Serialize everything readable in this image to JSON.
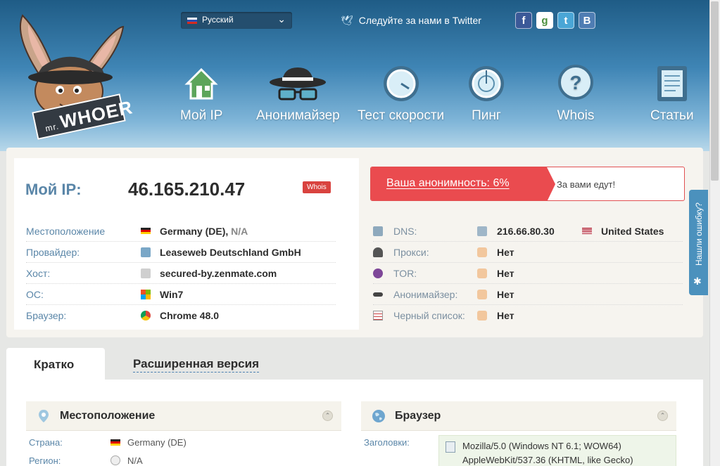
{
  "header": {
    "language": "Русский",
    "twitter_text": "Следуйте за нами в Twitter",
    "social": [
      {
        "name": "facebook",
        "glyph": "f",
        "color": "#3b5998"
      },
      {
        "name": "google",
        "glyph": "g",
        "color": "#4a8f3c"
      },
      {
        "name": "twitter",
        "glyph": "t",
        "color": "#4aa6d6"
      },
      {
        "name": "vk",
        "glyph": "B",
        "color": "#4f7db3"
      }
    ],
    "logo_text": "WHOER",
    "logo_prefix": "mr.",
    "nav": [
      "Мой IP",
      "Анонимайзер",
      "Тест скорости",
      "Пинг",
      "Whois",
      "Статьи"
    ]
  },
  "ip_card": {
    "label": "Мой IP:",
    "ip": "46.165.210.47",
    "whois_badge": "Whois",
    "rows": [
      {
        "label": "Местоположение",
        "value": "Germany (DE),",
        "value_extra": "N/A",
        "icon": "flag-de-icon"
      },
      {
        "label": "Провайдер:",
        "value": "Leaseweb Deutschland GmbH",
        "icon": "document-icon"
      },
      {
        "label": "Хост:",
        "value": "secured-by.zenmate.com",
        "icon": "server-icon"
      },
      {
        "label": "ОС:",
        "value": "Win7",
        "icon": "windows-icon"
      },
      {
        "label": "Браузер:",
        "value": "Chrome 48.0",
        "icon": "chrome-icon"
      }
    ]
  },
  "anonymity": {
    "percent_text": "Ваша анонимность: 6%",
    "message": "За вами едут!"
  },
  "checks": [
    {
      "label": "DNS:",
      "value": "216.66.80.30",
      "country": "United States",
      "icon": "dns-icon"
    },
    {
      "label": "Прокси:",
      "value": "Нет",
      "icon": "proxy-spy-icon"
    },
    {
      "label": "TOR:",
      "value": "Нет",
      "icon": "tor-onion-icon"
    },
    {
      "label": "Анонимайзер:",
      "value": "Нет",
      "icon": "glasses-icon"
    },
    {
      "label": "Черный список:",
      "value": "Нет",
      "icon": "blacklist-icon"
    }
  ],
  "feedback": "Нашли ошибку?",
  "tabs": {
    "active": "Кратко",
    "other": "Расширенная версия"
  },
  "location_section": {
    "title": "Местоположение",
    "rows": [
      {
        "label": "Страна:",
        "value": "Germany (DE)"
      },
      {
        "label": "Регион:",
        "value": "N/A"
      }
    ]
  },
  "browser_section": {
    "title": "Браузер",
    "headers_label": "Заголовки:",
    "ua_line1": "Mozilla/5.0 (Windows NT 6.1; WOW64)",
    "ua_line2": "AppleWebKit/537.36 (KHTML, like Gecko)"
  }
}
